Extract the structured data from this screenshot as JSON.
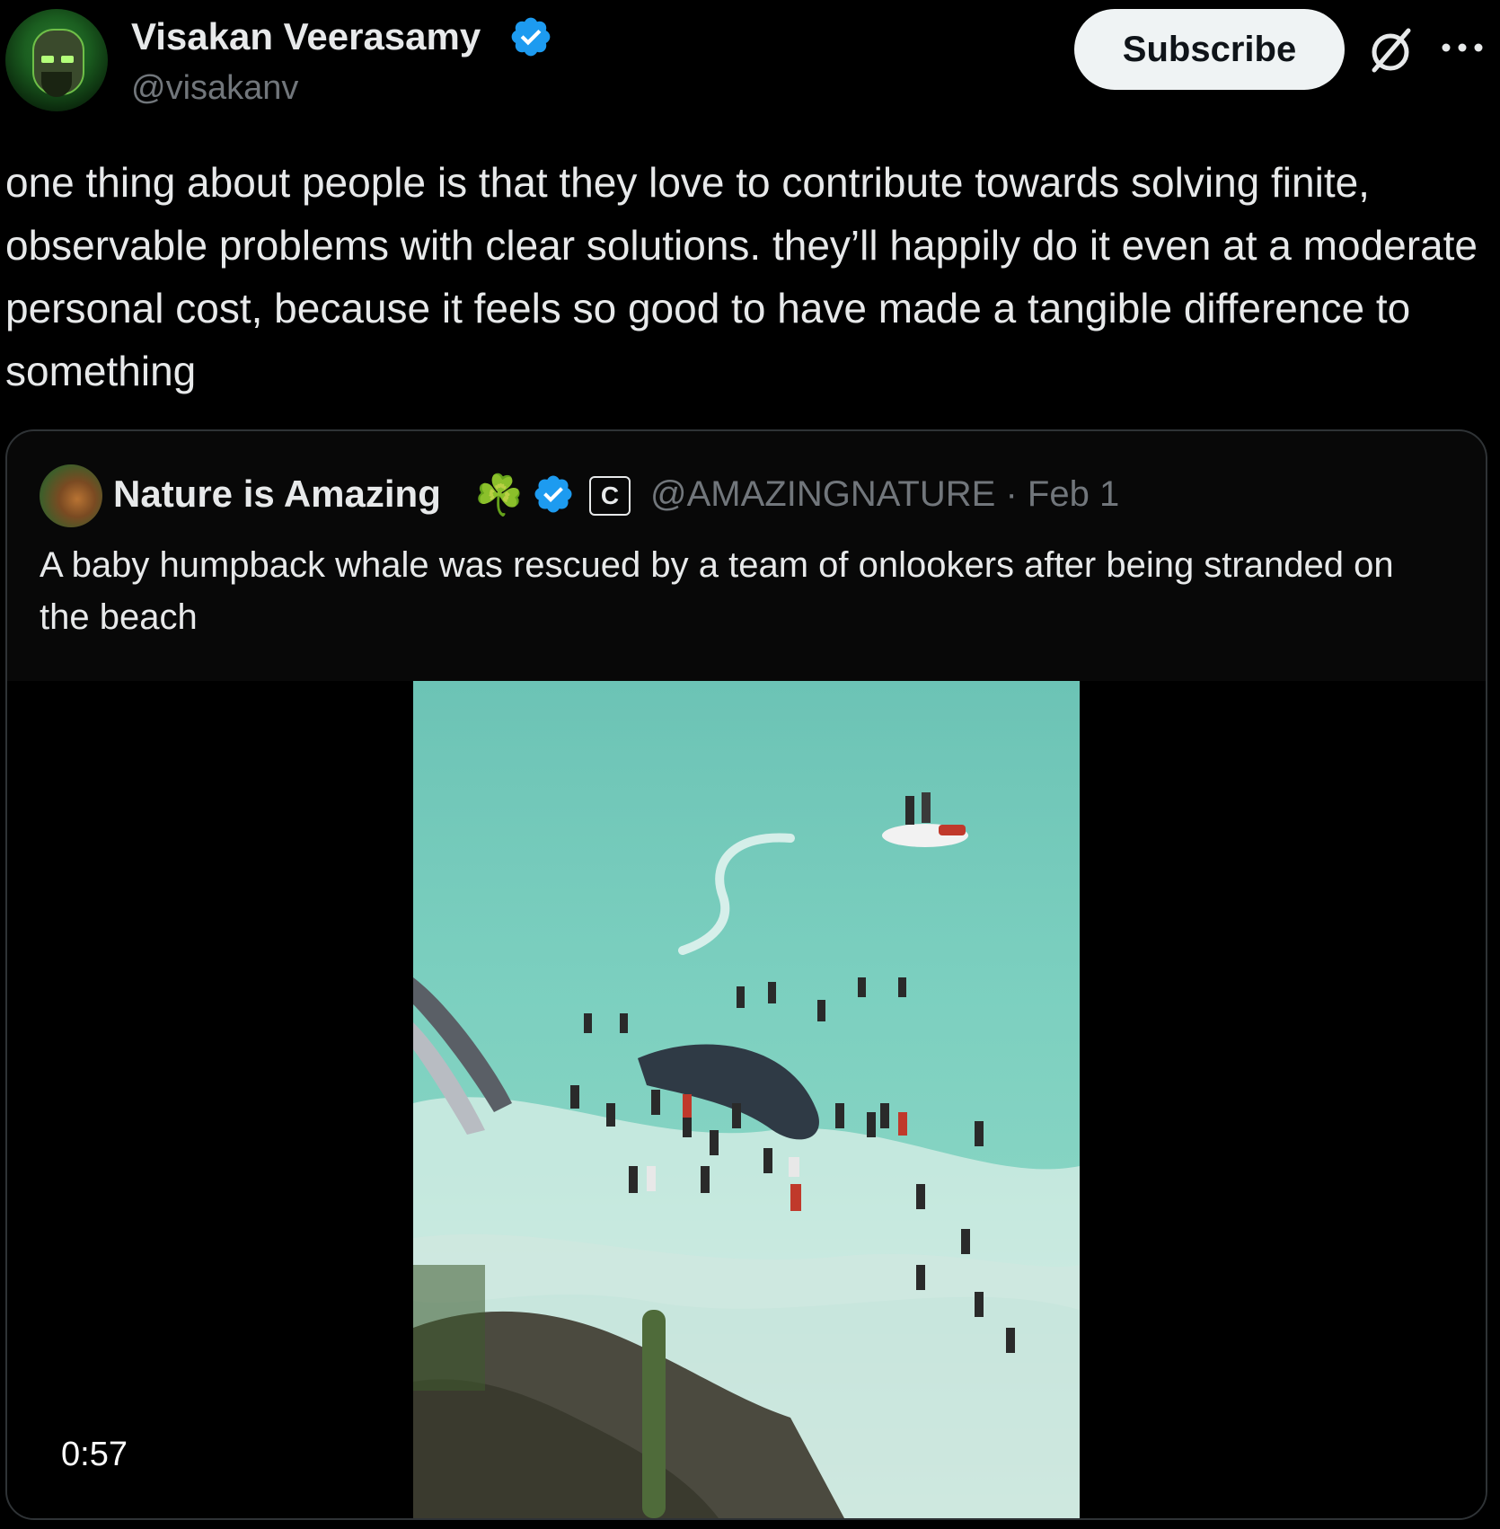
{
  "post": {
    "author": {
      "name": "Visakan Veerasamy",
      "handle": "@visakanv"
    },
    "actions": {
      "subscribe_label": "Subscribe",
      "grok_icon": "grok-icon",
      "more_icon": "more-icon"
    },
    "text": "one thing about people is that they love to contribute towards solving finite, observable problems with clear solutions. they’ll happily do it even at a moderate personal cost, because it feels so good to have made a tangible difference to something"
  },
  "quote": {
    "author": {
      "name": "Nature is Amazing",
      "emoji": "☘️",
      "badge": "C",
      "handle": "@AMAZINGNATURE",
      "separator": "·",
      "date": "Feb 1"
    },
    "text": "A baby humpback whale was rescued by a team of onlookers after being stranded on the beach",
    "media": {
      "type": "video",
      "duration": "0:57"
    }
  },
  "colors": {
    "background": "#000000",
    "text_primary": "#e7e9ea",
    "text_secondary": "#71767b",
    "verified_blue": "#1d9bf0",
    "subscribe_bg": "#eff3f4",
    "card_border": "#2f3336"
  }
}
